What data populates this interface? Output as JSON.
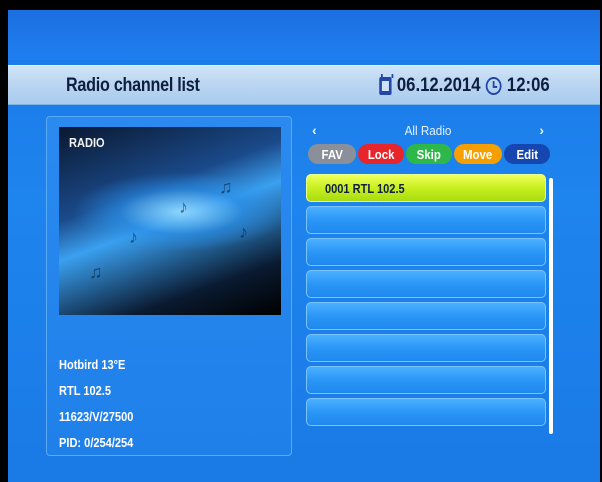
{
  "header": {
    "title": "Radio channel list",
    "date": "06.12.2014",
    "time": "12:06"
  },
  "icons": {
    "date": "calendar-icon",
    "time": "clock-icon",
    "prev": "chevron-left-icon",
    "next": "chevron-right-icon"
  },
  "preview": {
    "label": "RADIO"
  },
  "info": {
    "satellite": "Hotbird 13°E",
    "channel": "RTL 102.5",
    "transponder": "11623/V/27500",
    "pid": "PID: 0/254/254"
  },
  "nav": {
    "prev": "‹",
    "group": "All Radio",
    "next": "›"
  },
  "buttons": [
    {
      "label": "FAV",
      "color": "#8a8f99"
    },
    {
      "label": "Lock",
      "color": "#e8252a"
    },
    {
      "label": "Skip",
      "color": "#2fb84a"
    },
    {
      "label": "Move",
      "color": "#f5a000"
    },
    {
      "label": "Edit",
      "color": "#1646b0"
    }
  ],
  "channels": [
    "0001 RTL 102.5",
    "",
    "",
    "",
    "",
    "",
    "",
    "",
    ""
  ]
}
